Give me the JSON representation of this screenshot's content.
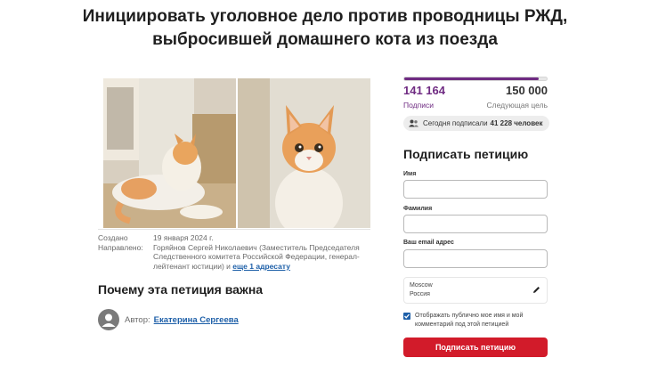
{
  "petition": {
    "title": "Инициировать уголовное дело против проводницы РЖД, выбросившей домашнего кота из поезда",
    "photos": [
      "cat-lying-icon",
      "cat-sitting-icon"
    ],
    "created_label": "Создано",
    "created_date": "19 января 2024 г.",
    "directed_label": "Направлено:",
    "directed_to": "Горяйнов Сергей Николаевич (Заместитель Председателя Следственного комитета Российской Федерации, генерал-лейтенант юстиции) и",
    "directed_more": "еще 1 адресату",
    "why_heading": "Почему эта петиция важна",
    "author_label": "Автор:",
    "author_name": "Екатерина Сергеева"
  },
  "stats": {
    "signatures": "141 164",
    "signatures_label": "Подписи",
    "goal": "150 000",
    "goal_label": "Следующая цель",
    "progress_fraction": 0.941,
    "today_prefix": "Сегодня подписали",
    "today_count": "41 228 человек"
  },
  "form": {
    "heading": "Подписать петицию",
    "first_name_label": "Имя",
    "first_name_value": "",
    "last_name_label": "Фамилия",
    "last_name_value": "",
    "email_label": "Ваш email адрес",
    "email_value": "",
    "city": "Moscow",
    "country": "Россия",
    "consent_text": "Отображать публично мое имя и мой комментарий под этой петицией",
    "consent_checked": true,
    "submit_label": "Подписать петицию"
  },
  "colors": {
    "accent_purple": "#6f2b82",
    "submit_red": "#d21b2a",
    "link_blue": "#1d5fa8"
  }
}
